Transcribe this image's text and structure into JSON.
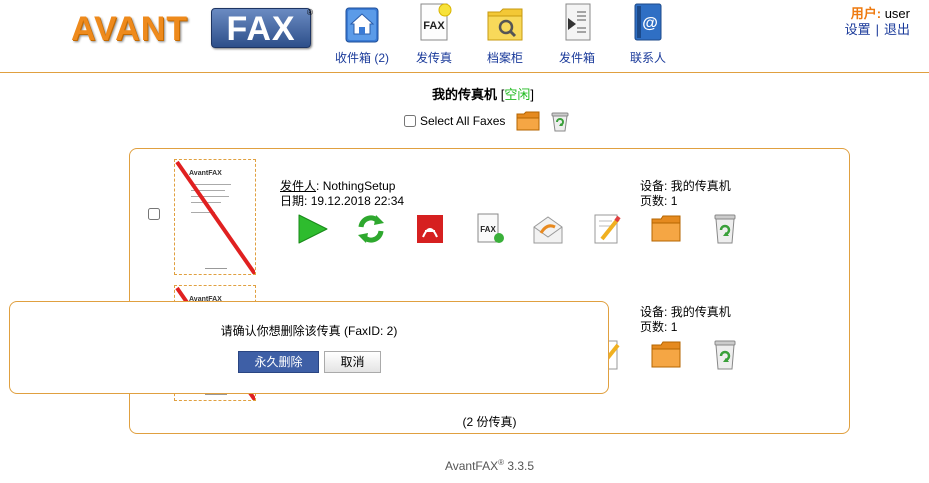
{
  "brand": {
    "logo_left": "AVANT",
    "logo_right": "FAX",
    "logo_reg": "®"
  },
  "nav": [
    {
      "label": "收件箱 (2)",
      "icon": "inbox-home-icon"
    },
    {
      "label": "发传真",
      "icon": "send-fax-icon"
    },
    {
      "label": "档案柜",
      "icon": "archive-cabinet-icon"
    },
    {
      "label": "发件箱",
      "icon": "outbox-icon"
    },
    {
      "label": "联系人",
      "icon": "contacts-icon"
    }
  ],
  "user": {
    "label": "用户:",
    "name": "user",
    "settings": "设置",
    "sep": "|",
    "logout": "退出"
  },
  "title": {
    "text": "我的传真机",
    "open": "[",
    "status": "空闲",
    "close": "]"
  },
  "select_all": {
    "label": "Select All Faxes"
  },
  "faxes": [
    {
      "sender_label": "发件人",
      "sender_sep": ":",
      "sender": "NothingSetup",
      "date_label": "日期:",
      "date": "19.12.2018 22:34",
      "device_label": "设备:",
      "device": "我的传真机",
      "pages_label": "页数:",
      "pages": "1"
    },
    {
      "sender_label": "",
      "sender_sep": "",
      "sender": "",
      "date_label": "",
      "date": "",
      "device_label": "设备:",
      "device": "我的传真机",
      "pages_label": "页数:",
      "pages": "1"
    }
  ],
  "thumb": {
    "logo": "AvantFAX"
  },
  "count": "(2 份传真)",
  "dialog": {
    "message": "请确认你想删除该传真 (FaxID: 2)",
    "delete": "永久删除",
    "cancel": "取消"
  },
  "footer": {
    "name": "AvantFAX",
    "reg": "®",
    "version": "3.3.5"
  },
  "colors": {
    "accent": "#e0a040",
    "link": "#1a3a9a",
    "status": "#22bb22",
    "button": "#3e5fa6"
  }
}
